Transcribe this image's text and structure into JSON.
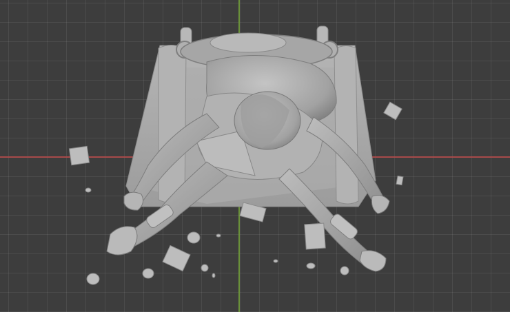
{
  "viewport": {
    "background_color": "#3d3d3d",
    "x_axis_color": "#b24a4a",
    "y_axis_color": "#6f9a3a",
    "model_color": "#a9a9a9",
    "model_shadow_color": "#8a8a8a",
    "model_highlight_color": "#c2c2c2"
  },
  "scene": {
    "object": "sculpted-figure-on-base",
    "debris_count": 16
  }
}
